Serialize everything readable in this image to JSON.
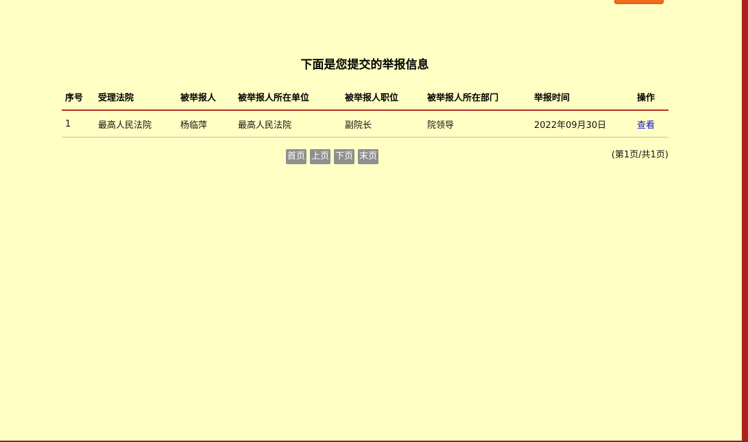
{
  "page": {
    "title": "下面是您提交的举报信息",
    "colors": {
      "background": "#FFFFC4",
      "accent_border": "#A8241C",
      "header_rule": "#B0301F",
      "link": "#1010D0",
      "pager_button": "#8F8F8F",
      "top_button": "#F26A1B"
    }
  },
  "table": {
    "headers": [
      "序号",
      "受理法院",
      "被举报人",
      "被举报人所在单位",
      "被举报人职位",
      "被举报人所在部门",
      "举报时间",
      "操作"
    ],
    "rows": [
      {
        "index": "1",
        "court": "最高人民法院",
        "reported_person": "杨临萍",
        "unit": "最高人民法院",
        "position": "副院长",
        "department": "院领导",
        "time": "2022年09月30日",
        "action": "查看"
      }
    ]
  },
  "pager": {
    "first": "首页",
    "prev": "上页",
    "next": "下页",
    "last": "末页",
    "info": "(第1页/共1页)"
  }
}
